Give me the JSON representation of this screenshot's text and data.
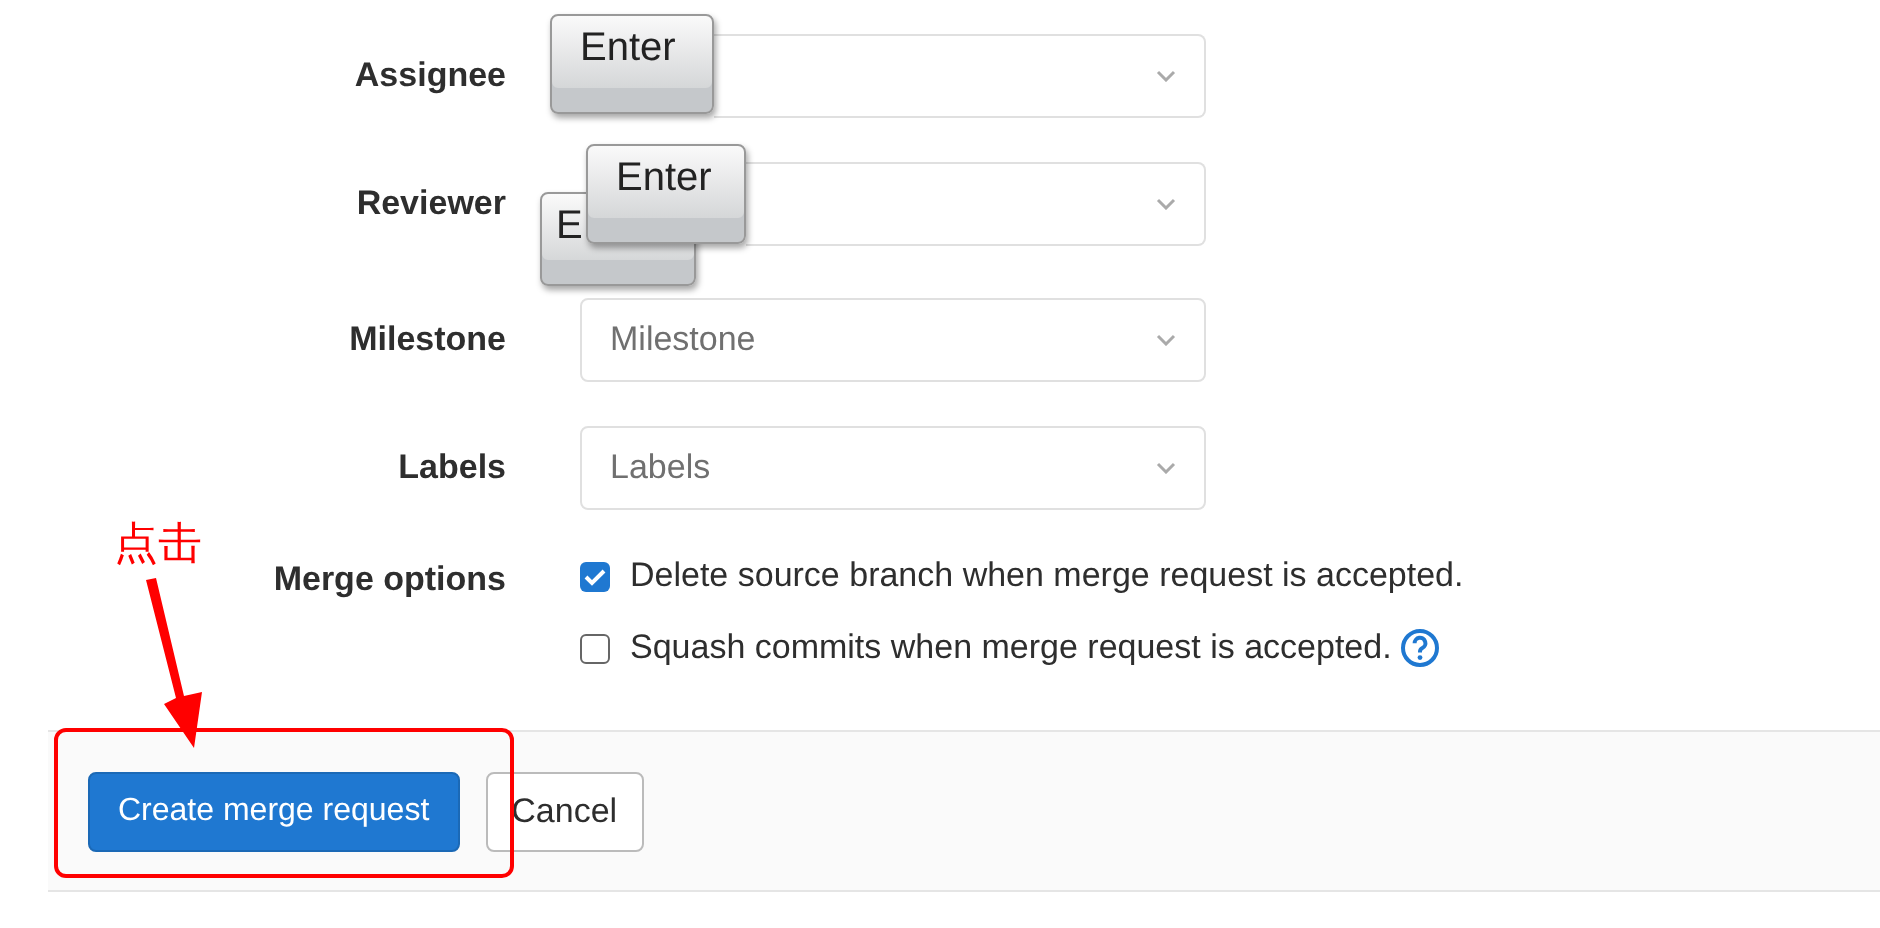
{
  "fields": [
    {
      "label": "Assignee"
    },
    {
      "label": "Reviewer"
    },
    {
      "label": "Milestone",
      "placeholder": "Milestone"
    },
    {
      "label": "Labels",
      "placeholder": "Labels"
    }
  ],
  "merge_options": {
    "label": "Merge options",
    "options": [
      {
        "text": "Delete source branch when merge request is accepted.",
        "checked": true,
        "help": false
      },
      {
        "text": "Squash commits when merge request is accepted.",
        "checked": false,
        "help": true
      }
    ]
  },
  "buttons": [
    {
      "label": "Create merge request",
      "kind": "primary"
    },
    {
      "label": "Cancel",
      "kind": "secondary"
    }
  ],
  "overlay_keys": [
    {
      "label": "Enter"
    },
    {
      "label": "E"
    },
    {
      "label": "Enter"
    }
  ],
  "annotation": {
    "text": "点击"
  }
}
